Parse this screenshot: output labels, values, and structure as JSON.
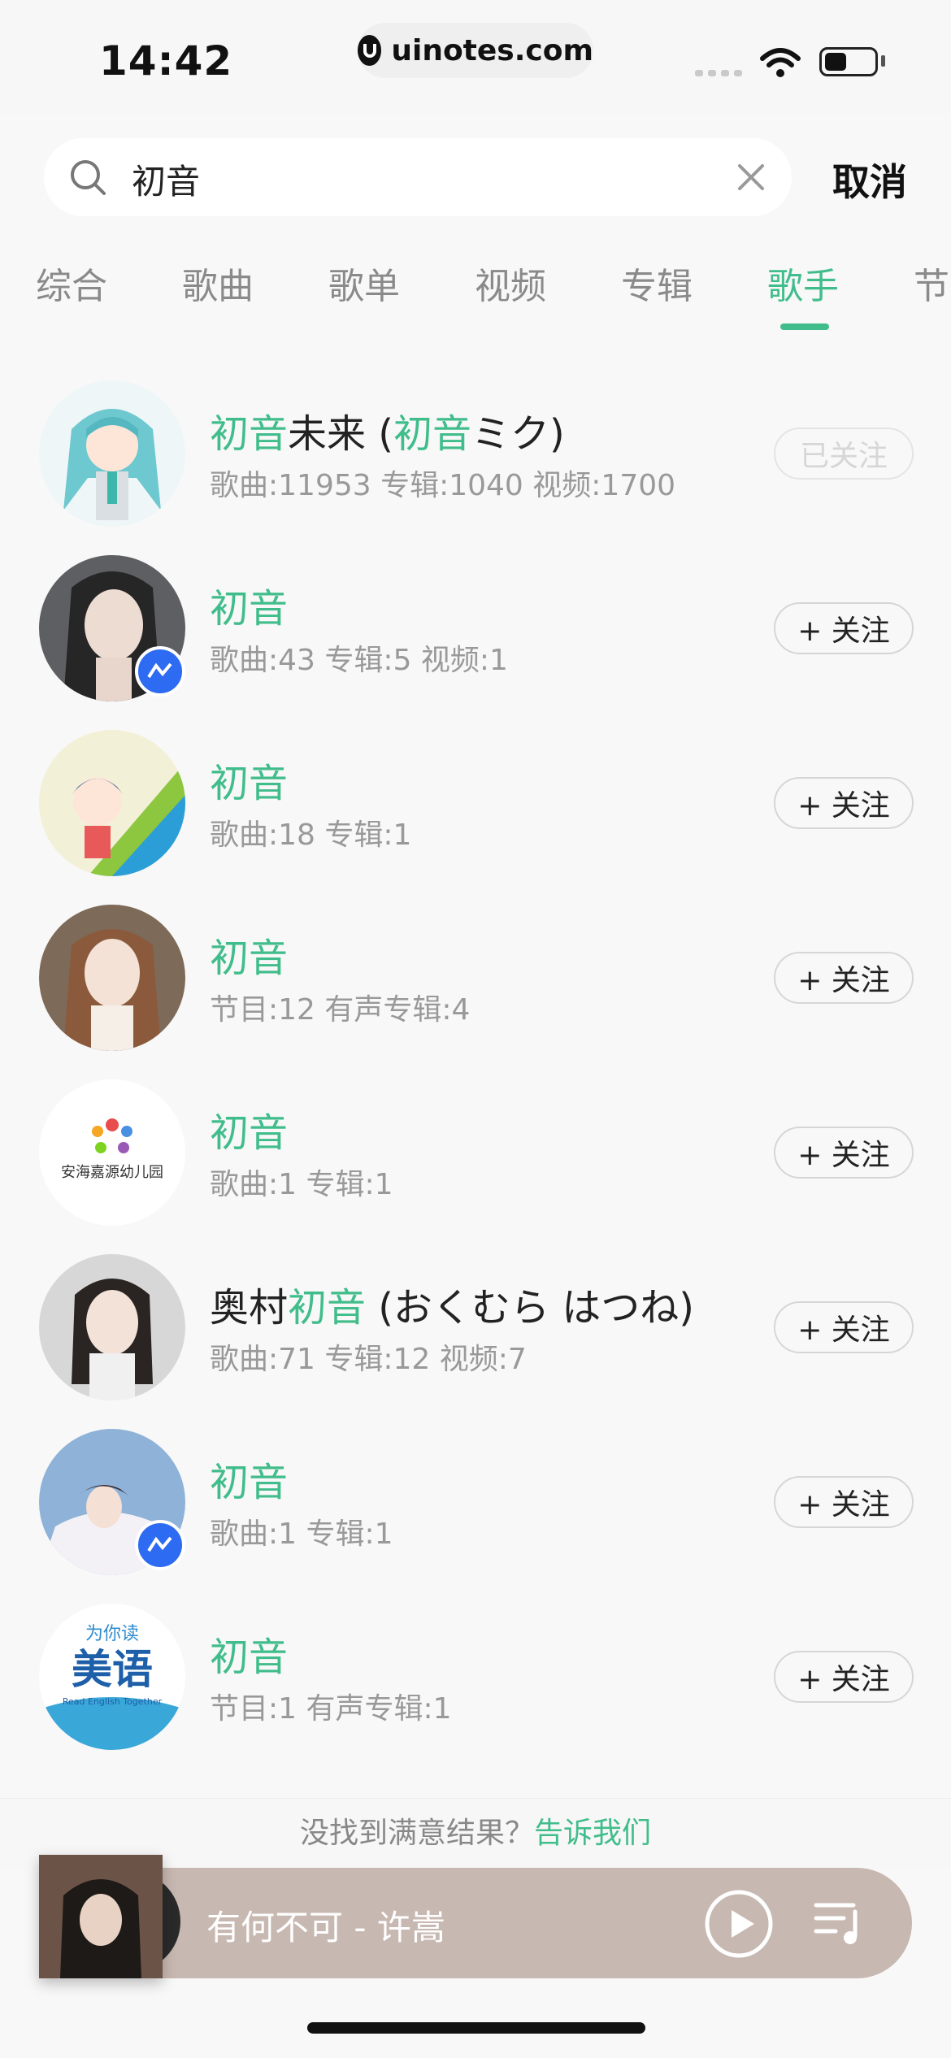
{
  "status_bar": {
    "time": "14:42",
    "url": "uinotes.com",
    "battery_level": 0.45
  },
  "search": {
    "query": "初音",
    "cancel_label": "取消"
  },
  "tabs": [
    {
      "label": "综合"
    },
    {
      "label": "歌曲"
    },
    {
      "label": "歌单"
    },
    {
      "label": "视频"
    },
    {
      "label": "专辑"
    },
    {
      "label": "歌手"
    },
    {
      "label": "节"
    }
  ],
  "active_tab": "歌手",
  "artists": [
    {
      "name_hl": "初音",
      "name_rest": "未来 (",
      "name_hl2": "初音",
      "name_tail": "ミク)",
      "stats": "歌曲:11953  专辑:1040  视频:1700",
      "follow_label": "已关注",
      "followed": true,
      "avatar": "anime-miku-avatar"
    },
    {
      "name_pre": "",
      "name_hl": "初音",
      "name_rest": "",
      "stats": "歌曲:43  专辑:5  视频:1",
      "follow_label": "+ 关注",
      "followed": false,
      "avatar": "woman-portrait-avatar",
      "badge": true
    },
    {
      "name_pre": "",
      "name_hl": "初音",
      "name_rest": "",
      "stats": "歌曲:18  专辑:1",
      "follow_label": "+ 关注",
      "followed": false,
      "avatar": "cartoon-avatar"
    },
    {
      "name_pre": "",
      "name_hl": "初音",
      "name_rest": "",
      "stats": "节目:12  有声专辑:4",
      "follow_label": "+ 关注",
      "followed": false,
      "avatar": "woman-portrait-avatar"
    },
    {
      "name_pre": "",
      "name_hl": "初音",
      "name_rest": "",
      "stats": "歌曲:1  专辑:1",
      "follow_label": "+ 关注",
      "followed": false,
      "avatar": "kindergarten-logo-avatar",
      "logo_text": "安海嘉源幼儿园"
    },
    {
      "name_pre": "奥村",
      "name_hl": "初音",
      "name_rest": " (おくむら はつね)",
      "stats": "歌曲:71  专辑:12  视频:7",
      "follow_label": "+ 关注",
      "followed": false,
      "avatar": "woman-portrait-avatar"
    },
    {
      "name_pre": "",
      "name_hl": "初音",
      "name_rest": "",
      "stats": "歌曲:1  专辑:1",
      "follow_label": "+ 关注",
      "followed": false,
      "avatar": "woman-lying-avatar",
      "badge": true
    },
    {
      "name_pre": "",
      "name_hl": "初音",
      "name_rest": "",
      "stats": "节目:1  有声专辑:1",
      "follow_label": "+ 关注",
      "followed": false,
      "avatar": "english-logo-avatar",
      "logo_text": "为你读",
      "logo_big": "美语",
      "logo_sub": "Read English Together"
    }
  ],
  "feedback": {
    "text": "没找到满意结果？",
    "link": "告诉我们"
  },
  "player": {
    "song": "有何不可 - 许嵩"
  },
  "colors": {
    "accent": "#41bd8b",
    "player_bg": "#c7b8b1"
  }
}
